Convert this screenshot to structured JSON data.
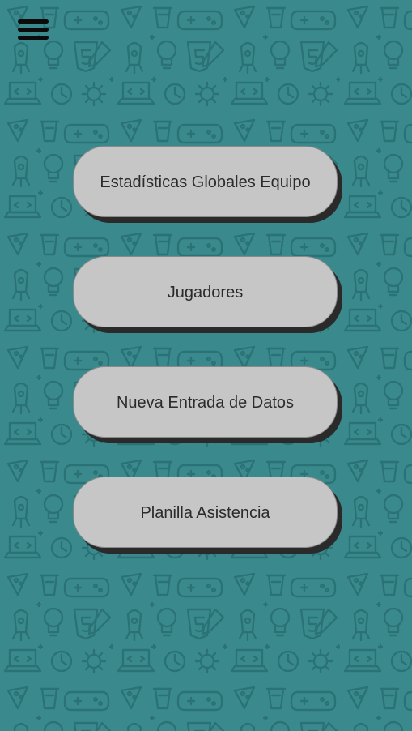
{
  "background": {
    "color": "#3a8a8d",
    "pattern_color": "#2c7477",
    "pattern_icons": [
      "pizza-icon",
      "coffee-cup-icon",
      "gamepad-icon",
      "rocket-icon",
      "lightbulb-icon",
      "html5-icon",
      "laptop-icon",
      "pencil-icon",
      "clock-icon",
      "gear-icon"
    ]
  },
  "header": {
    "menu_icon": "hamburger-menu-icon"
  },
  "menu": {
    "items": [
      {
        "label": "Estadísticas Globales Equipo"
      },
      {
        "label": "Jugadores"
      },
      {
        "label": "Nueva Entrada de Datos"
      },
      {
        "label": "Planilla Asistencia"
      }
    ]
  }
}
